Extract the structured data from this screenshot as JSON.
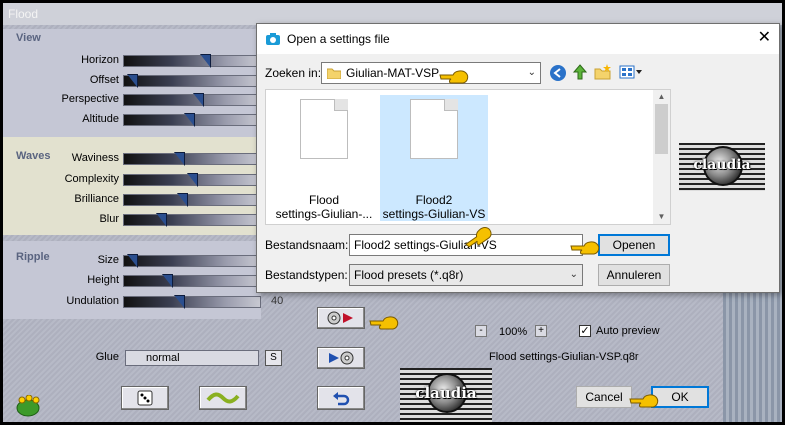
{
  "flood": {
    "title": "Flood",
    "sections": {
      "view": "View",
      "waves": "Waves",
      "ripple": "Ripple"
    },
    "sliders": [
      {
        "label": "Horizon",
        "level": 0.6
      },
      {
        "label": "Offset",
        "level": 0.02
      },
      {
        "label": "Perspective",
        "level": 0.55
      },
      {
        "label": "Altitude",
        "level": 0.48
      },
      {
        "label": "Waviness",
        "level": 0.4
      },
      {
        "label": "Complexity",
        "level": 0.5
      },
      {
        "label": "Brilliance",
        "level": 0.42
      },
      {
        "label": "Blur",
        "level": 0.25
      },
      {
        "label": "Size",
        "level": 0.02
      },
      {
        "label": "Height",
        "level": 0.3
      },
      {
        "label": "Undulation",
        "level": 0.4
      }
    ],
    "value_shown": "40",
    "glue_label": "Glue",
    "glue_value": "normal",
    "s_button": "S",
    "zoom_minus": "-",
    "zoom_value": "100%",
    "zoom_plus": "+",
    "auto_preview_label": "Auto preview",
    "auto_preview_checked": "✓",
    "preset_name": "Flood settings-Giulian-VSP.q8r",
    "cancel_label": "Cancel",
    "ok_label": "OK",
    "thumb_text": "claudia"
  },
  "dialog": {
    "title": "Open a settings file",
    "close": "✕",
    "lookin_label": "Zoeken in:",
    "lookin_value": "Giulian-MAT-VSP",
    "files": [
      {
        "name_line1": "Flood",
        "name_line2": "settings-Giulian-...",
        "selected": false
      },
      {
        "name_line1": "Flood2",
        "name_line2": "settings-Giulian-VS",
        "selected": true
      }
    ],
    "filename_label": "Bestandsnaam:",
    "filename_value": "Flood2 settings-Giulian-VS",
    "filetype_label": "Bestandstypen:",
    "filetype_value": "Flood presets (*.q8r)",
    "open_label": "Openen",
    "cancel_label": "Annuleren",
    "preview_text": "claudia"
  },
  "colors": {
    "accent": "#0078d7",
    "selection": "#cce8ff",
    "hand": "#f5c000"
  }
}
